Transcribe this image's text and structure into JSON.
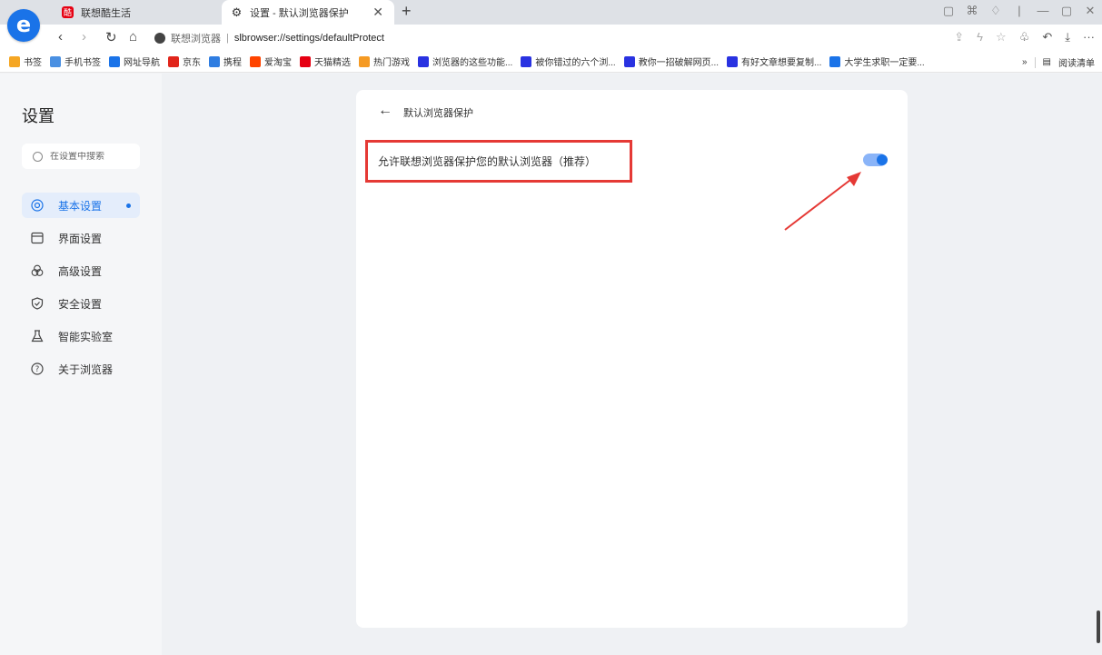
{
  "tabs": [
    {
      "title": "联想酷生活"
    },
    {
      "title": "设置 - 默认浏览器保护"
    }
  ],
  "address": {
    "site_name": "联想浏览器",
    "url": "slbrowser://settings/defaultProtect"
  },
  "bookmarks": [
    {
      "label": "书签",
      "color": "#f5a623",
      "icon": "star-icon"
    },
    {
      "label": "手机书签",
      "color": "#4a90e2",
      "icon": "phone-icon"
    },
    {
      "label": "网址导航",
      "color": "#1a73e8",
      "icon": "browser-icon"
    },
    {
      "label": "京东",
      "color": "#e1251b",
      "icon": "jd-icon"
    },
    {
      "label": "携程",
      "color": "#2f7de1",
      "icon": "ctrip-icon"
    },
    {
      "label": "爱淘宝",
      "color": "#ff4400",
      "icon": "taobao-icon"
    },
    {
      "label": "天猫精选",
      "color": "#e60012",
      "icon": "tmall-icon"
    },
    {
      "label": "热门游戏",
      "color": "#f59a23",
      "icon": "game-icon"
    },
    {
      "label": "浏览器的这些功能...",
      "color": "#2932e1",
      "icon": "baidu-icon"
    },
    {
      "label": "被你错过的六个浏...",
      "color": "#2932e1",
      "icon": "baidu-icon"
    },
    {
      "label": "教你一招破解网页...",
      "color": "#2932e1",
      "icon": "baidu-icon"
    },
    {
      "label": "有好文章想要复制...",
      "color": "#2932e1",
      "icon": "baidu-icon"
    },
    {
      "label": "大学生求职一定要...",
      "color": "#1a73e8",
      "icon": "zhihu-icon"
    }
  ],
  "bookmarks_more": "»",
  "reading_list": "阅读清单",
  "sidebar": {
    "title": "设置",
    "search_placeholder": "在设置中搜索",
    "items": [
      {
        "label": "基本设置",
        "icon": "basic-settings-icon",
        "active": true
      },
      {
        "label": "界面设置",
        "icon": "interface-settings-icon",
        "active": false
      },
      {
        "label": "高级设置",
        "icon": "advanced-settings-icon",
        "active": false
      },
      {
        "label": "安全设置",
        "icon": "security-shield-icon",
        "active": false
      },
      {
        "label": "智能实验室",
        "icon": "lab-flask-icon",
        "active": false
      },
      {
        "label": "关于浏览器",
        "icon": "help-question-icon",
        "active": false
      }
    ]
  },
  "content": {
    "page_title": "默认浏览器保护",
    "option_label": "允许联想浏览器保护您的默认浏览器（推荐）",
    "toggle_on": true
  },
  "colors": {
    "accent": "#1a73e8",
    "highlight": "#e53935"
  }
}
